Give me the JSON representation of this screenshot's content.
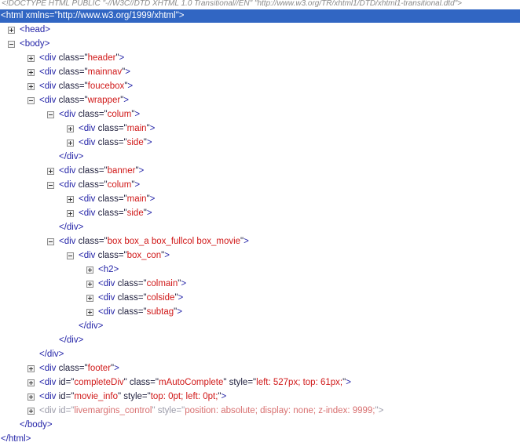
{
  "doctype": "<!DOCTYPE HTML PUBLIC \"-//W3C//DTD XHTML 1.0 Transitional//EN\" \"http://www.w3.org/TR/xhtml1/DTD/xhtml1-transitional.dtd\">",
  "colors": {
    "selection": "#3166c3",
    "tag": "#2424a8",
    "value": "#d01818"
  },
  "rows": [
    {
      "level": 0,
      "exp": "",
      "selected": true,
      "parts": [
        [
          "t",
          "<html "
        ],
        [
          "a",
          "xmlns=\""
        ],
        [
          "a",
          "http://www.w3.org/1999/xhtml"
        ],
        [
          "a",
          "\""
        ],
        [
          "t",
          ">"
        ]
      ]
    },
    {
      "level": 1,
      "exp": "plus",
      "parts": [
        [
          "t",
          "<head>"
        ]
      ]
    },
    {
      "level": 1,
      "exp": "minus",
      "parts": [
        [
          "t",
          "<body>"
        ]
      ]
    },
    {
      "level": 2,
      "exp": "plus",
      "parts": [
        [
          "t",
          "<div "
        ],
        [
          "a",
          "class=\""
        ],
        [
          "v",
          "header"
        ],
        [
          "a",
          "\""
        ],
        [
          "t",
          ">"
        ]
      ]
    },
    {
      "level": 2,
      "exp": "plus",
      "parts": [
        [
          "t",
          "<div "
        ],
        [
          "a",
          "class=\""
        ],
        [
          "v",
          "mainnav"
        ],
        [
          "a",
          "\""
        ],
        [
          "t",
          ">"
        ]
      ]
    },
    {
      "level": 2,
      "exp": "plus",
      "parts": [
        [
          "t",
          "<div "
        ],
        [
          "a",
          "class=\""
        ],
        [
          "v",
          "foucebox"
        ],
        [
          "a",
          "\""
        ],
        [
          "t",
          ">"
        ]
      ]
    },
    {
      "level": 2,
      "exp": "minus",
      "parts": [
        [
          "t",
          "<div "
        ],
        [
          "a",
          "class=\""
        ],
        [
          "v",
          "wrapper"
        ],
        [
          "a",
          "\""
        ],
        [
          "t",
          ">"
        ]
      ]
    },
    {
      "level": 3,
      "exp": "minus",
      "parts": [
        [
          "t",
          "<div "
        ],
        [
          "a",
          "class=\""
        ],
        [
          "v",
          "colum"
        ],
        [
          "a",
          "\""
        ],
        [
          "t",
          ">"
        ]
      ]
    },
    {
      "level": 4,
      "exp": "plus",
      "parts": [
        [
          "t",
          "<div "
        ],
        [
          "a",
          "class=\""
        ],
        [
          "v",
          "main"
        ],
        [
          "a",
          "\""
        ],
        [
          "t",
          ">"
        ]
      ]
    },
    {
      "level": 4,
      "exp": "plus",
      "parts": [
        [
          "t",
          "<div "
        ],
        [
          "a",
          "class=\""
        ],
        [
          "v",
          "side"
        ],
        [
          "a",
          "\""
        ],
        [
          "t",
          ">"
        ]
      ]
    },
    {
      "level": 3,
      "exp": "",
      "parts": [
        [
          "t",
          "</div>"
        ]
      ]
    },
    {
      "level": 3,
      "exp": "plus",
      "parts": [
        [
          "t",
          "<div "
        ],
        [
          "a",
          "class=\""
        ],
        [
          "v",
          "banner"
        ],
        [
          "a",
          "\""
        ],
        [
          "t",
          ">"
        ]
      ]
    },
    {
      "level": 3,
      "exp": "minus",
      "parts": [
        [
          "t",
          "<div "
        ],
        [
          "a",
          "class=\""
        ],
        [
          "v",
          "colum"
        ],
        [
          "a",
          "\""
        ],
        [
          "t",
          ">"
        ]
      ]
    },
    {
      "level": 4,
      "exp": "plus",
      "parts": [
        [
          "t",
          "<div "
        ],
        [
          "a",
          "class=\""
        ],
        [
          "v",
          "main"
        ],
        [
          "a",
          "\""
        ],
        [
          "t",
          ">"
        ]
      ]
    },
    {
      "level": 4,
      "exp": "plus",
      "parts": [
        [
          "t",
          "<div "
        ],
        [
          "a",
          "class=\""
        ],
        [
          "v",
          "side"
        ],
        [
          "a",
          "\""
        ],
        [
          "t",
          ">"
        ]
      ]
    },
    {
      "level": 3,
      "exp": "",
      "parts": [
        [
          "t",
          "</div>"
        ]
      ]
    },
    {
      "level": 3,
      "exp": "minus",
      "parts": [
        [
          "t",
          "<div "
        ],
        [
          "a",
          "class=\""
        ],
        [
          "v",
          "box box_a box_fullcol box_movie"
        ],
        [
          "a",
          "\""
        ],
        [
          "t",
          ">"
        ]
      ]
    },
    {
      "level": 4,
      "exp": "minus",
      "parts": [
        [
          "t",
          "<div "
        ],
        [
          "a",
          "class=\""
        ],
        [
          "v",
          "box_con"
        ],
        [
          "a",
          "\""
        ],
        [
          "t",
          ">"
        ]
      ]
    },
    {
      "level": 5,
      "exp": "plus",
      "parts": [
        [
          "t",
          "<h2>"
        ]
      ]
    },
    {
      "level": 5,
      "exp": "plus",
      "parts": [
        [
          "t",
          "<div "
        ],
        [
          "a",
          "class=\""
        ],
        [
          "v",
          "colmain"
        ],
        [
          "a",
          "\""
        ],
        [
          "t",
          ">"
        ]
      ]
    },
    {
      "level": 5,
      "exp": "plus",
      "parts": [
        [
          "t",
          "<div "
        ],
        [
          "a",
          "class=\""
        ],
        [
          "v",
          "colside"
        ],
        [
          "a",
          "\""
        ],
        [
          "t",
          ">"
        ]
      ]
    },
    {
      "level": 5,
      "exp": "plus",
      "parts": [
        [
          "t",
          "<div "
        ],
        [
          "a",
          "class=\""
        ],
        [
          "v",
          "subtag"
        ],
        [
          "a",
          "\""
        ],
        [
          "t",
          ">"
        ]
      ]
    },
    {
      "level": 4,
      "exp": "",
      "parts": [
        [
          "t",
          "</div>"
        ]
      ]
    },
    {
      "level": 3,
      "exp": "",
      "parts": [
        [
          "t",
          "</div>"
        ]
      ]
    },
    {
      "level": 2,
      "exp": "",
      "parts": [
        [
          "t",
          "</div>"
        ]
      ]
    },
    {
      "level": 2,
      "exp": "plus",
      "parts": [
        [
          "t",
          "<div "
        ],
        [
          "a",
          "class=\""
        ],
        [
          "v",
          "footer"
        ],
        [
          "a",
          "\""
        ],
        [
          "t",
          ">"
        ]
      ]
    },
    {
      "level": 2,
      "exp": "plus",
      "parts": [
        [
          "t",
          "<div "
        ],
        [
          "a",
          "id=\""
        ],
        [
          "v",
          "completeDiv"
        ],
        [
          "a",
          "\" class=\""
        ],
        [
          "v",
          "mAutoComplete"
        ],
        [
          "a",
          "\" style=\""
        ],
        [
          "v",
          "left: 527px; top: 61px;"
        ],
        [
          "a",
          "\""
        ],
        [
          "t",
          ">"
        ]
      ]
    },
    {
      "level": 2,
      "exp": "plus",
      "parts": [
        [
          "t",
          "<div "
        ],
        [
          "a",
          "id=\""
        ],
        [
          "v",
          "movie_info"
        ],
        [
          "a",
          "\" style=\""
        ],
        [
          "v",
          "top: 0pt; left: 0pt;"
        ],
        [
          "a",
          "\""
        ],
        [
          "t",
          ">"
        ]
      ]
    },
    {
      "level": 2,
      "exp": "plus",
      "dim": true,
      "parts": [
        [
          "t",
          "<div "
        ],
        [
          "a",
          "id=\""
        ],
        [
          "v",
          "livemargins_control"
        ],
        [
          "a",
          "\" style=\""
        ],
        [
          "v",
          "position: absolute; display: none; z-index: 9999;"
        ],
        [
          "a",
          "\""
        ],
        [
          "t",
          ">"
        ]
      ]
    },
    {
      "level": 1,
      "exp": "",
      "parts": [
        [
          "t",
          "</body>"
        ]
      ]
    },
    {
      "level": 0,
      "exp": "",
      "parts": [
        [
          "t",
          "</html>"
        ]
      ]
    }
  ]
}
